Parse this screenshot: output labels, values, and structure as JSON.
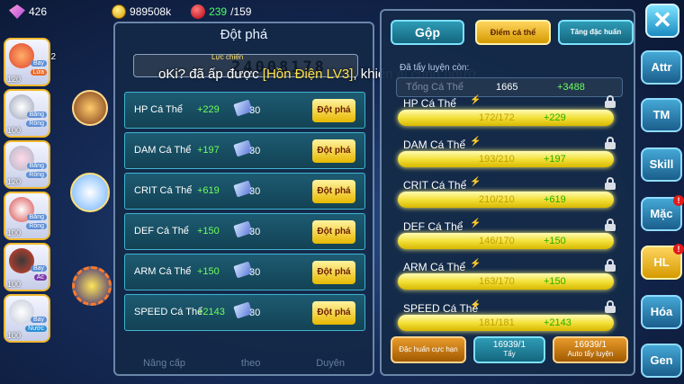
{
  "topbar": {
    "gems": "426",
    "coins": "989508k",
    "energy": "239",
    "energy_max": "/159"
  },
  "roster": [
    {
      "level": "120",
      "tags": [
        "Bay",
        "Lửa"
      ],
      "num": "2",
      "color": "#e0402a"
    },
    {
      "level": "100",
      "tags": [
        "Băng",
        "Rồng"
      ],
      "num": "",
      "color": "#ffffff"
    },
    {
      "level": "120",
      "tags": [
        "Băng",
        "Rồng"
      ],
      "num": "",
      "color": "#b0b5c8"
    },
    {
      "level": "100",
      "tags": [
        "Băng",
        "Rồng"
      ],
      "num": "",
      "color": "#d84a4a"
    },
    {
      "level": "100",
      "tags": [
        "Bay",
        "Ác"
      ],
      "num": "",
      "color": "#d8402a"
    },
    {
      "level": "100",
      "tags": [
        "Bay",
        "Nước"
      ],
      "num": "",
      "color": "#c0c7d8"
    }
  ],
  "dialog": {
    "title": "Đột phá",
    "power_label": "Lực chiến",
    "power_value": "24008178",
    "rows": [
      {
        "name": "HP Cá Thể",
        "bonus": "+229",
        "count": "30",
        "button": "Đột phá"
      },
      {
        "name": "DAM Cá Thể",
        "bonus": "+197",
        "count": "30",
        "button": "Đột phá"
      },
      {
        "name": "CRIT Cá Thể",
        "bonus": "+619",
        "count": "30",
        "button": "Đột phá"
      },
      {
        "name": "DEF Cá Thể",
        "bonus": "+150",
        "count": "30",
        "button": "Đột phá"
      },
      {
        "name": "ARM Cá Thể",
        "bonus": "+150",
        "count": "30",
        "button": "Đột phá"
      },
      {
        "name": "SPEED Cá Thể",
        "bonus": "+2143",
        "count": "30",
        "button": "Đột phá"
      }
    ],
    "bottom": [
      "Nâng cấp",
      "theo",
      "Duyên"
    ]
  },
  "banner": {
    "prefix": "oKi? đã ấp được ",
    "highlight": "[Hồn Điện LV3]",
    "suffix": ", khiến ai cũng ngưỡ"
  },
  "panel": {
    "tabs": {
      "gop": "Gộp",
      "diem": "Điểm cá thể",
      "tang": "Tăng đặc huấn"
    },
    "remain_label": "Đã tẩy luyện còn:",
    "remain_name": "Tổng Cá Thể",
    "remain_value": "1665",
    "remain_bonus": "+3488",
    "stats": [
      {
        "name": "HP Cá Thể",
        "value": "172/172",
        "bonus": "+229"
      },
      {
        "name": "DAM Cá Thể",
        "value": "193/210",
        "bonus": "+197"
      },
      {
        "name": "CRIT Cá Thể",
        "value": "210/210",
        "bonus": "+619"
      },
      {
        "name": "DEF Cá Thể",
        "value": "146/170",
        "bonus": "+150"
      },
      {
        "name": "ARM Cá Thể",
        "value": "163/170",
        "bonus": "+150"
      },
      {
        "name": "SPEED Cá Thể",
        "value": "181/181",
        "bonus": "+2143"
      }
    ],
    "buttons": {
      "dac_huan": "Đặc huấn cực hạn",
      "tay_count": "16939/1",
      "tay_label": "Tẩy",
      "auto_count": "16939/1",
      "auto_label": "Auto tẩy luyện"
    }
  },
  "nav": {
    "close": "✕",
    "items": [
      {
        "label": "Attr",
        "badge": false
      },
      {
        "label": "TM",
        "badge": false
      },
      {
        "label": "Skill",
        "badge": false
      },
      {
        "label": "Mặc",
        "badge": true
      },
      {
        "label": "HL",
        "badge": true
      },
      {
        "label": "Hóa",
        "badge": false
      },
      {
        "label": "Gen",
        "badge": false
      }
    ],
    "badge_text": "!"
  },
  "colors": {
    "accent_green": "#6dff5a",
    "gold": "#e7b800",
    "bar_glow": "#f3e13a"
  }
}
